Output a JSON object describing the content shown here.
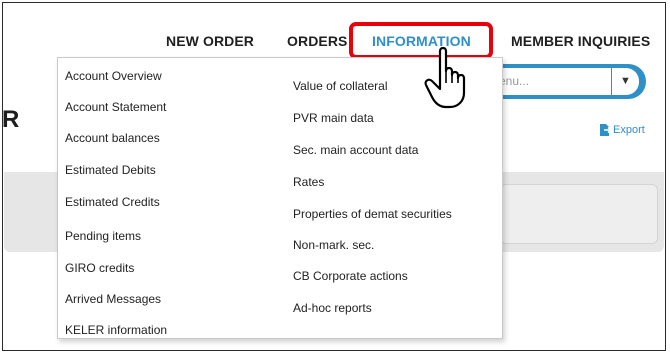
{
  "nav": {
    "items": [
      "NEW ORDER",
      "ORDERS",
      "INFORMATION",
      "MEMBER INQUIRIES"
    ],
    "active": "INFORMATION"
  },
  "search": {
    "placeholder": "enu..."
  },
  "export_label": "Export",
  "partial_title": "R",
  "menu": {
    "left": [
      "Account Overview",
      "Account Statement",
      "Account balances",
      "Estimated Debits",
      "Estimated Credits",
      "Pending items",
      "GIRO credits",
      "Arrived Messages",
      "KELER information"
    ],
    "right": [
      "Value of collateral",
      "PVR main data",
      "Sec. main account data",
      "Rates",
      "Properties of demat securities",
      "Non-mark. sec.",
      "CB Corporate actions",
      "Ad-hoc reports"
    ]
  },
  "colors": {
    "accent": "#2f8fc7",
    "highlight": "#e8000b"
  },
  "icons": {
    "cursor": "hand-pointer-icon",
    "dropdown": "chevron-down-icon",
    "export": "export-icon"
  }
}
